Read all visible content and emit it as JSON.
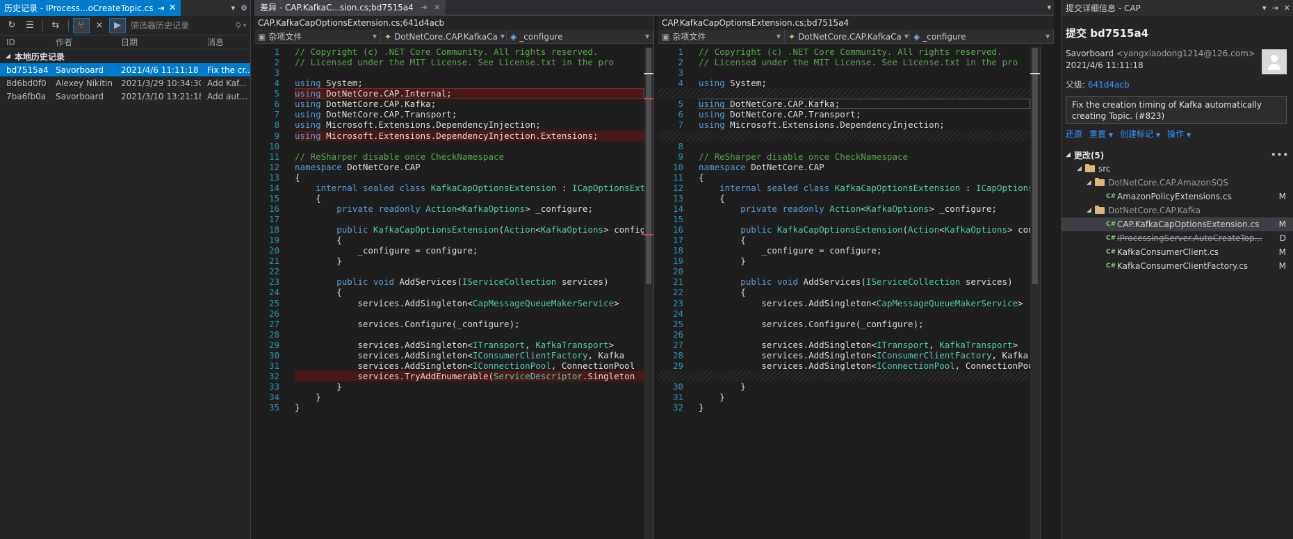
{
  "history": {
    "tab_title": "历史记录 - IProcess...oCreateTopic.cs",
    "filter_placeholder": "筛选器历史记录",
    "columns": [
      "ID",
      "作者",
      "日期",
      "消息"
    ],
    "group_label": "本地历史记录",
    "rows": [
      {
        "id": "bd7515a4",
        "author": "Savorboard",
        "date": "2021/4/6 11:11:18",
        "message": "Fix the cr..."
      },
      {
        "id": "8d6bd0f0",
        "author": "Alexey Nikitin",
        "date": "2021/3/29 10:34:30",
        "message": "Add Kaf..."
      },
      {
        "id": "7ba6fb0a",
        "author": "Savorboard",
        "date": "2021/3/10 13:21:18",
        "message": "Add aut..."
      }
    ]
  },
  "diff": {
    "tab_title": "差异 - CAP.KafkaC...sion.cs;bd7515a4",
    "left": {
      "title": "CAP.KafkaCapOptionsExtension.cs;641d4acb",
      "nav": [
        "杂项文件",
        "DotNetCore.CAP.KafkaCa",
        "_configure"
      ]
    },
    "right": {
      "title": "CAP.KafkaCapOptionsExtension.cs;bd7515a4",
      "nav": [
        "杂项文件",
        "DotNetCore.CAP.KafkaCa",
        "_configure"
      ]
    },
    "left_lines": [
      {
        "n": "1",
        "t": "// Copyright (c) .NET Core Community. All rights reserved.",
        "k": "c"
      },
      {
        "n": "2",
        "t": "// Licensed under the MIT License. See License.txt in the pro",
        "k": "c"
      },
      {
        "n": "3",
        "t": "",
        "k": ""
      },
      {
        "n": "4",
        "t": "using System;",
        "k": ""
      },
      {
        "n": "5",
        "t": "using DotNetCore.CAP.Internal;",
        "k": "r"
      },
      {
        "n": "6",
        "t": "using DotNetCore.CAP.Kafka;",
        "k": ""
      },
      {
        "n": "7",
        "t": "using DotNetCore.CAP.Transport;",
        "k": ""
      },
      {
        "n": "8",
        "t": "using Microsoft.Extensions.DependencyInjection;",
        "k": ""
      },
      {
        "n": "9",
        "t": "using Microsoft.Extensions.DependencyInjection.Extensions;",
        "k": "r"
      },
      {
        "n": "10",
        "t": "",
        "k": ""
      },
      {
        "n": "11",
        "t": "// ReSharper disable once CheckNamespace",
        "k": "c"
      },
      {
        "n": "12",
        "t": "namespace DotNetCore.CAP",
        "k": ""
      },
      {
        "n": "13",
        "t": "{",
        "k": ""
      },
      {
        "n": "14",
        "t": "    internal sealed class KafkaCapOptionsExtension : ICapOptionsExtension",
        "k": ""
      },
      {
        "n": "15",
        "t": "    {",
        "k": ""
      },
      {
        "n": "16",
        "t": "        private readonly Action<KafkaOptions> _configure;",
        "k": ""
      },
      {
        "n": "17",
        "t": "",
        "k": ""
      },
      {
        "n": "18",
        "t": "        public KafkaCapOptionsExtension(Action<KafkaOptions> configure)",
        "k": ""
      },
      {
        "n": "19",
        "t": "        {",
        "k": ""
      },
      {
        "n": "20",
        "t": "            _configure = configure;",
        "k": ""
      },
      {
        "n": "21",
        "t": "        }",
        "k": ""
      },
      {
        "n": "22",
        "t": "",
        "k": ""
      },
      {
        "n": "23",
        "t": "        public void AddServices(IServiceCollection services)",
        "k": ""
      },
      {
        "n": "24",
        "t": "        {",
        "k": ""
      },
      {
        "n": "25",
        "t": "            services.AddSingleton<CapMessageQueueMakerService>",
        "k": ""
      },
      {
        "n": "26",
        "t": "",
        "k": ""
      },
      {
        "n": "27",
        "t": "            services.Configure(_configure);",
        "k": ""
      },
      {
        "n": "28",
        "t": "",
        "k": ""
      },
      {
        "n": "29",
        "t": "            services.AddSingleton<ITransport, KafkaTransport>",
        "k": ""
      },
      {
        "n": "30",
        "t": "            services.AddSingleton<IConsumerClientFactory, Kafka",
        "k": ""
      },
      {
        "n": "31",
        "t": "            services.AddSingleton<IConnectionPool, ConnectionPool",
        "k": ""
      },
      {
        "n": "32",
        "t": "            services.TryAddEnumerable(ServiceDescriptor.Singleton",
        "k": "r"
      },
      {
        "n": "33",
        "t": "        }",
        "k": ""
      },
      {
        "n": "34",
        "t": "    }",
        "k": ""
      },
      {
        "n": "35",
        "t": "}",
        "k": ""
      }
    ],
    "right_lines": [
      {
        "n": "1",
        "t": "// Copyright (c) .NET Core Community. All rights reserved.",
        "k": "c"
      },
      {
        "n": "2",
        "t": "// Licensed under the MIT License. See License.txt in the pro",
        "k": "c"
      },
      {
        "n": "3",
        "t": "",
        "k": ""
      },
      {
        "n": "4",
        "t": "using System;",
        "k": ""
      },
      {
        "n": "",
        "t": "",
        "k": "f"
      },
      {
        "n": "5",
        "t": "using DotNetCore.CAP.Kafka;",
        "k": "g"
      },
      {
        "n": "6",
        "t": "using DotNetCore.CAP.Transport;",
        "k": ""
      },
      {
        "n": "7",
        "t": "using Microsoft.Extensions.DependencyInjection;",
        "k": ""
      },
      {
        "n": "",
        "t": "",
        "k": "f"
      },
      {
        "n": "8",
        "t": "",
        "k": ""
      },
      {
        "n": "9",
        "t": "// ReSharper disable once CheckNamespace",
        "k": "c"
      },
      {
        "n": "10",
        "t": "namespace DotNetCore.CAP",
        "k": ""
      },
      {
        "n": "11",
        "t": "{",
        "k": ""
      },
      {
        "n": "12",
        "t": "    internal sealed class KafkaCapOptionsExtension : ICapOptionsExtension",
        "k": ""
      },
      {
        "n": "13",
        "t": "    {",
        "k": ""
      },
      {
        "n": "14",
        "t": "        private readonly Action<KafkaOptions> _configure;",
        "k": ""
      },
      {
        "n": "15",
        "t": "",
        "k": ""
      },
      {
        "n": "16",
        "t": "        public KafkaCapOptionsExtension(Action<KafkaOptions> configure)",
        "k": ""
      },
      {
        "n": "17",
        "t": "        {",
        "k": ""
      },
      {
        "n": "18",
        "t": "            _configure = configure;",
        "k": ""
      },
      {
        "n": "19",
        "t": "        }",
        "k": ""
      },
      {
        "n": "20",
        "t": "",
        "k": ""
      },
      {
        "n": "21",
        "t": "        public void AddServices(IServiceCollection services)",
        "k": ""
      },
      {
        "n": "22",
        "t": "        {",
        "k": ""
      },
      {
        "n": "23",
        "t": "            services.AddSingleton<CapMessageQueueMakerService>",
        "k": ""
      },
      {
        "n": "24",
        "t": "",
        "k": ""
      },
      {
        "n": "25",
        "t": "            services.Configure(_configure);",
        "k": ""
      },
      {
        "n": "26",
        "t": "",
        "k": ""
      },
      {
        "n": "27",
        "t": "            services.AddSingleton<ITransport, KafkaTransport>",
        "k": ""
      },
      {
        "n": "28",
        "t": "            services.AddSingleton<IConsumerClientFactory, Kafka",
        "k": ""
      },
      {
        "n": "29",
        "t": "            services.AddSingleton<IConnectionPool, ConnectionPool",
        "k": ""
      },
      {
        "n": "",
        "t": "",
        "k": "f"
      },
      {
        "n": "30",
        "t": "        }",
        "k": ""
      },
      {
        "n": "31",
        "t": "    }",
        "k": ""
      },
      {
        "n": "32",
        "t": "}",
        "k": ""
      }
    ]
  },
  "details": {
    "tab_title": "提交详细信息 - CAP",
    "commit_title": "提交 bd7515a4",
    "author": "Savorboard",
    "email": "<yangxiaodong1214@126.com>",
    "date": "2021/4/6 11:11:18",
    "parent_label": "父级:",
    "parent_hash": "641d4acb",
    "message": "Fix the creation timing of Kafka automatically creating Topic.  (#823)",
    "actions": [
      "还原",
      "重置",
      "创建标记",
      "操作"
    ],
    "changes_header": "更改(5)",
    "more": "•••",
    "tree": {
      "root": "src",
      "folder1": "DotNetCore.CAP.AmazonSQS",
      "file1": "AmazonPolicyExtensions.cs",
      "file1_status": "M",
      "folder2": "DotNetCore.CAP.Kafka",
      "file2": "CAP.KafkaCapOptionsExtension.cs",
      "file2_status": "M",
      "file3": "IProcessingServer.AutoCreateTop...",
      "file3_status": "D",
      "file4": "KafkaConsumerClient.cs",
      "file4_status": "M",
      "file5": "KafkaConsumerClientFactory.cs",
      "file5_status": "M",
      "cs_badge": "C#"
    }
  }
}
